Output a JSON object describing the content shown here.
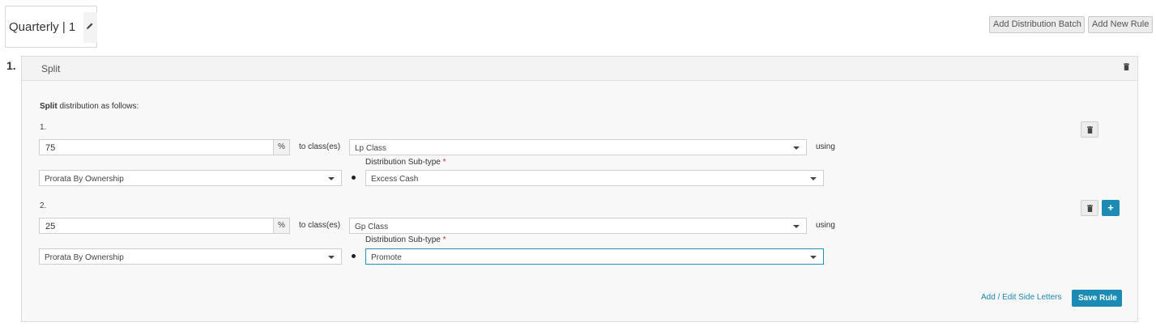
{
  "header": {
    "title": "Quarterly | 1",
    "add_batch_label": "Add Distribution Batch",
    "add_rule_label": "Add New Rule"
  },
  "rule": {
    "number": "1.",
    "type": "Split",
    "intro_bold": "Split",
    "intro_rest": " distribution as follows:",
    "rows": [
      {
        "number": "1.",
        "percent": "75",
        "unit": "%",
        "to_label": "to class(es)",
        "class": "Lp Class",
        "using_label": "using",
        "method": "Prorata By Ownership",
        "subtype_label": "Distribution Sub-type",
        "required_mark": "*",
        "subtype": "Excess Cash"
      },
      {
        "number": "2.",
        "percent": "25",
        "unit": "%",
        "to_label": "to class(es)",
        "class": "Gp Class",
        "using_label": "using",
        "method": "Prorata By Ownership",
        "subtype_label": "Distribution Sub-type",
        "required_mark": "*",
        "subtype": "Promote"
      }
    ],
    "plus_label": "+",
    "side_letters_label": "Add / Edit Side Letters",
    "save_label": "Save Rule"
  },
  "icons": {
    "edit": "pencil-icon",
    "delete": "trash-icon",
    "add": "plus-icon",
    "dropdown": "chevron-down-icon"
  },
  "colors": {
    "accent": "#1b8bb3",
    "link": "#1b86b0",
    "required": "#d32f2f"
  }
}
